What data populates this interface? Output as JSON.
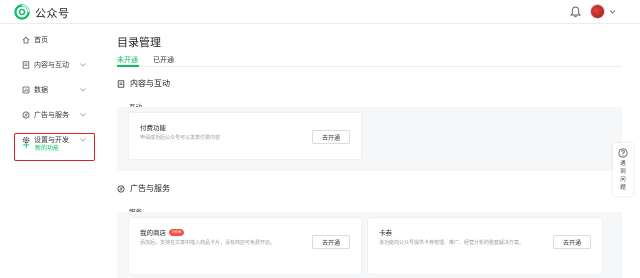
{
  "app": {
    "brand": "公众号"
  },
  "header": {
    "bell_icon": "bell-icon",
    "avatar_icon": "avatar",
    "caret_icon": "caret-down-icon"
  },
  "sidebar": {
    "items": [
      {
        "label": "首页",
        "icon": "home-icon",
        "has_chevron": false
      },
      {
        "label": "内容与互动",
        "icon": "document-icon",
        "has_chevron": true
      },
      {
        "label": "数据",
        "icon": "data-icon",
        "has_chevron": true
      },
      {
        "label": "广告与服务",
        "icon": "ad-icon",
        "has_chevron": true
      },
      {
        "label": "设置与开发",
        "icon": "gear-icon",
        "has_chevron": true
      }
    ],
    "new_function": {
      "label": "新的功能",
      "icon": "plus-icon"
    }
  },
  "main": {
    "title": "目录管理",
    "tabs": [
      {
        "label": "未开通",
        "active": true
      },
      {
        "label": "已开通",
        "active": false
      }
    ],
    "sections": [
      {
        "title": "内容与互动",
        "icon": "document-icon",
        "subsections": [
          {
            "title": "互动",
            "cards": [
              {
                "title": "付费功能",
                "desc": "申请成功后公众号可以发表付费内容",
                "button": "去开通"
              }
            ]
          }
        ]
      },
      {
        "title": "广告与服务",
        "icon": "compass-icon",
        "subsections": [
          {
            "title": "服务",
            "cards": [
              {
                "title": "我的商店",
                "badge": "new",
                "desc": "添加后，支持在文章中插入商品卡片，没有商店可免费开店。",
                "button": "去开通"
              },
              {
                "title": "卡券",
                "desc": "该功能向公众号提供卡券管理、推广、经营分析的整套解决方案。",
                "button": "去开通"
              }
            ]
          }
        ]
      }
    ]
  },
  "help": {
    "label": "遇到问题",
    "icon": "question-icon"
  },
  "colors": {
    "accent": "#07c160",
    "highlight_border": "#e02020",
    "badge": "#fa5151"
  }
}
